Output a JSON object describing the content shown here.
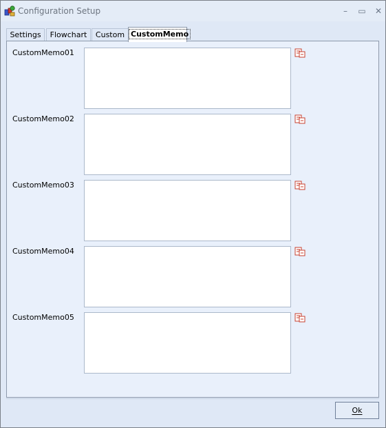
{
  "window": {
    "title": "Configuration Setup",
    "controls": {
      "minimize": "–",
      "maximize": "▭",
      "close": "✕"
    }
  },
  "tabs": [
    {
      "label": "Settings",
      "active": false
    },
    {
      "label": "Flowchart",
      "active": false
    },
    {
      "label": "Custom",
      "active": false
    },
    {
      "label": "CustomMemo",
      "active": true
    }
  ],
  "memos": [
    {
      "label": "CustomMemo01",
      "value": "",
      "icon": "memo-edit-icon"
    },
    {
      "label": "CustomMemo02",
      "value": "",
      "icon": "memo-edit-icon"
    },
    {
      "label": "CustomMemo03",
      "value": "",
      "icon": "memo-edit-icon"
    },
    {
      "label": "CustomMemo04",
      "value": "",
      "icon": "memo-edit-icon"
    },
    {
      "label": "CustomMemo05",
      "value": "",
      "icon": "memo-edit-icon"
    }
  ],
  "footer": {
    "ok_label": "Ok"
  },
  "colors": {
    "window_bg": "#dfe8f6",
    "page_bg": "#e9f0fb",
    "border": "#8d99ab",
    "icon_red": "#c8402f"
  }
}
